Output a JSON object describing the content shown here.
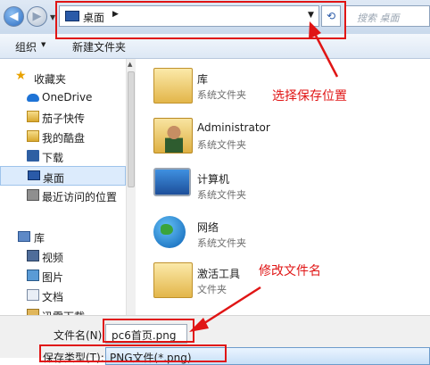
{
  "address": {
    "location": "桌面",
    "search_placeholder": "搜索 桌面"
  },
  "toolbar": {
    "organize": "组织",
    "new_folder": "新建文件夹"
  },
  "nav": {
    "favorites": "收藏夹",
    "items": [
      "OneDrive",
      "茄子快传",
      "我的酷盘",
      "下载",
      "桌面",
      "最近访问的位置"
    ],
    "libraries": "库",
    "lib_items": [
      "视频",
      "图片",
      "文档",
      "迅雷下载"
    ]
  },
  "content": [
    {
      "name": "库",
      "type": "系统文件夹"
    },
    {
      "name": "Administrator",
      "type": "系统文件夹"
    },
    {
      "name": "计算机",
      "type": "系统文件夹"
    },
    {
      "name": "网络",
      "type": "系统文件夹"
    },
    {
      "name": "激活工具",
      "type": "文件夹"
    }
  ],
  "annotations": {
    "save_location": "选择保存位置",
    "rename": "修改文件名"
  },
  "save": {
    "filename_label": "文件名(N):",
    "filename_value": "pc6首页.png",
    "filetype_label": "保存类型(T):",
    "filetype_value": "PNG文件(*.png)"
  },
  "colors": {
    "annotation_red": "#e01515",
    "selection": "#dcebfc"
  }
}
